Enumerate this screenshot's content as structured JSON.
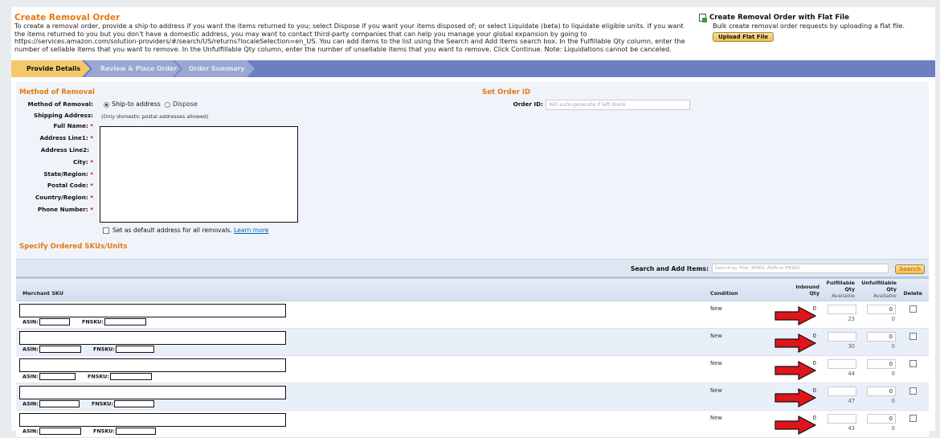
{
  "header": {
    "title": "Create Removal Order",
    "intro": "To create a removal order, provide a ship-to address if you want the items returned to you; select Dispose if you want your items disposed of; or select Liquidate (beta) to liquidate eligible units. If you want the items returned to you but you don't have a domestic address, you may want to contact third-party companies that can help you manage your global expansion by going to https://services.amazon.com/solution-providers/#/search/US/returns?localeSelection=en_US. You can add items to the list using the Search and Add Items search box. In the Fulfillable Qty column, enter the number of sellable items that you want to remove. In the Unfulfillable Qty column, enter the number of unsellable items that you want to remove. Click Continue. Note: Liquidations cannot be canceled."
  },
  "flat_file": {
    "icon": "document-icon",
    "title": "Create Removal Order with Flat File",
    "description": "Bulk create removal order requests by uploading a flat file.",
    "button": "Upload Flat File"
  },
  "steps": [
    "Provide Details",
    "Review & Place Order",
    "Order Summary"
  ],
  "method": {
    "heading": "Method of Removal",
    "label": "Method of Removal:",
    "options": [
      "Ship-to address",
      "Dispose"
    ],
    "selected": "Ship-to address",
    "shipping_label": "Shipping Address:",
    "shipping_note": "(Only domestic postal addresses allowed)",
    "fields": [
      "Full Name:",
      "Address Line1:",
      "Address Line2:",
      "City:",
      "State/Region:",
      "Postal Code:",
      "Country/Region:",
      "Phone Number:"
    ],
    "default_text": "Set as default address for all removals.",
    "learn_more": "Learn more"
  },
  "order": {
    "heading": "Set Order ID",
    "label": "Order ID:",
    "placeholder": "Will auto-generate if left blank"
  },
  "skus": {
    "heading": "Specify Ordered SKUs/Units",
    "search_label": "Search and Add Items:",
    "search_placeholder": "Search by Title, MSKU, ASIN or FNSKU",
    "search_button": "Search",
    "columns": {
      "merchant_sku": "Merchant SKU",
      "condition": "Condition",
      "inbound": "Inbound",
      "qty": "Qty",
      "fulfillable": "Fulfillable",
      "unfulfillable": "Unfulfillable",
      "available": "Available",
      "delete": "Delete"
    },
    "asin_label": "ASIN:",
    "fnsku_label": "FNSKU:",
    "rows": [
      {
        "condition": "New",
        "inbound": "0",
        "fulfillable_value": "",
        "fulfillable_available": "23",
        "unfulfillable_value": "0",
        "unfulfillable_available": "0"
      },
      {
        "condition": "New",
        "inbound": "0",
        "fulfillable_value": "",
        "fulfillable_available": "30",
        "unfulfillable_value": "0",
        "unfulfillable_available": "0"
      },
      {
        "condition": "New",
        "inbound": "0",
        "fulfillable_value": "",
        "fulfillable_available": "44",
        "unfulfillable_value": "0",
        "unfulfillable_available": "0"
      },
      {
        "condition": "New",
        "inbound": "0",
        "fulfillable_value": "",
        "fulfillable_available": "47",
        "unfulfillable_value": "0",
        "unfulfillable_available": "0"
      },
      {
        "condition": "New",
        "inbound": "0",
        "fulfillable_value": "",
        "fulfillable_available": "43",
        "unfulfillable_value": "0",
        "unfulfillable_available": "0"
      }
    ]
  },
  "colors": {
    "accent": "#e47911",
    "steps_bar": "#6d7fc2",
    "active_step": "#f4c96b",
    "arrow": "#e0141b",
    "link": "#0066c0"
  }
}
